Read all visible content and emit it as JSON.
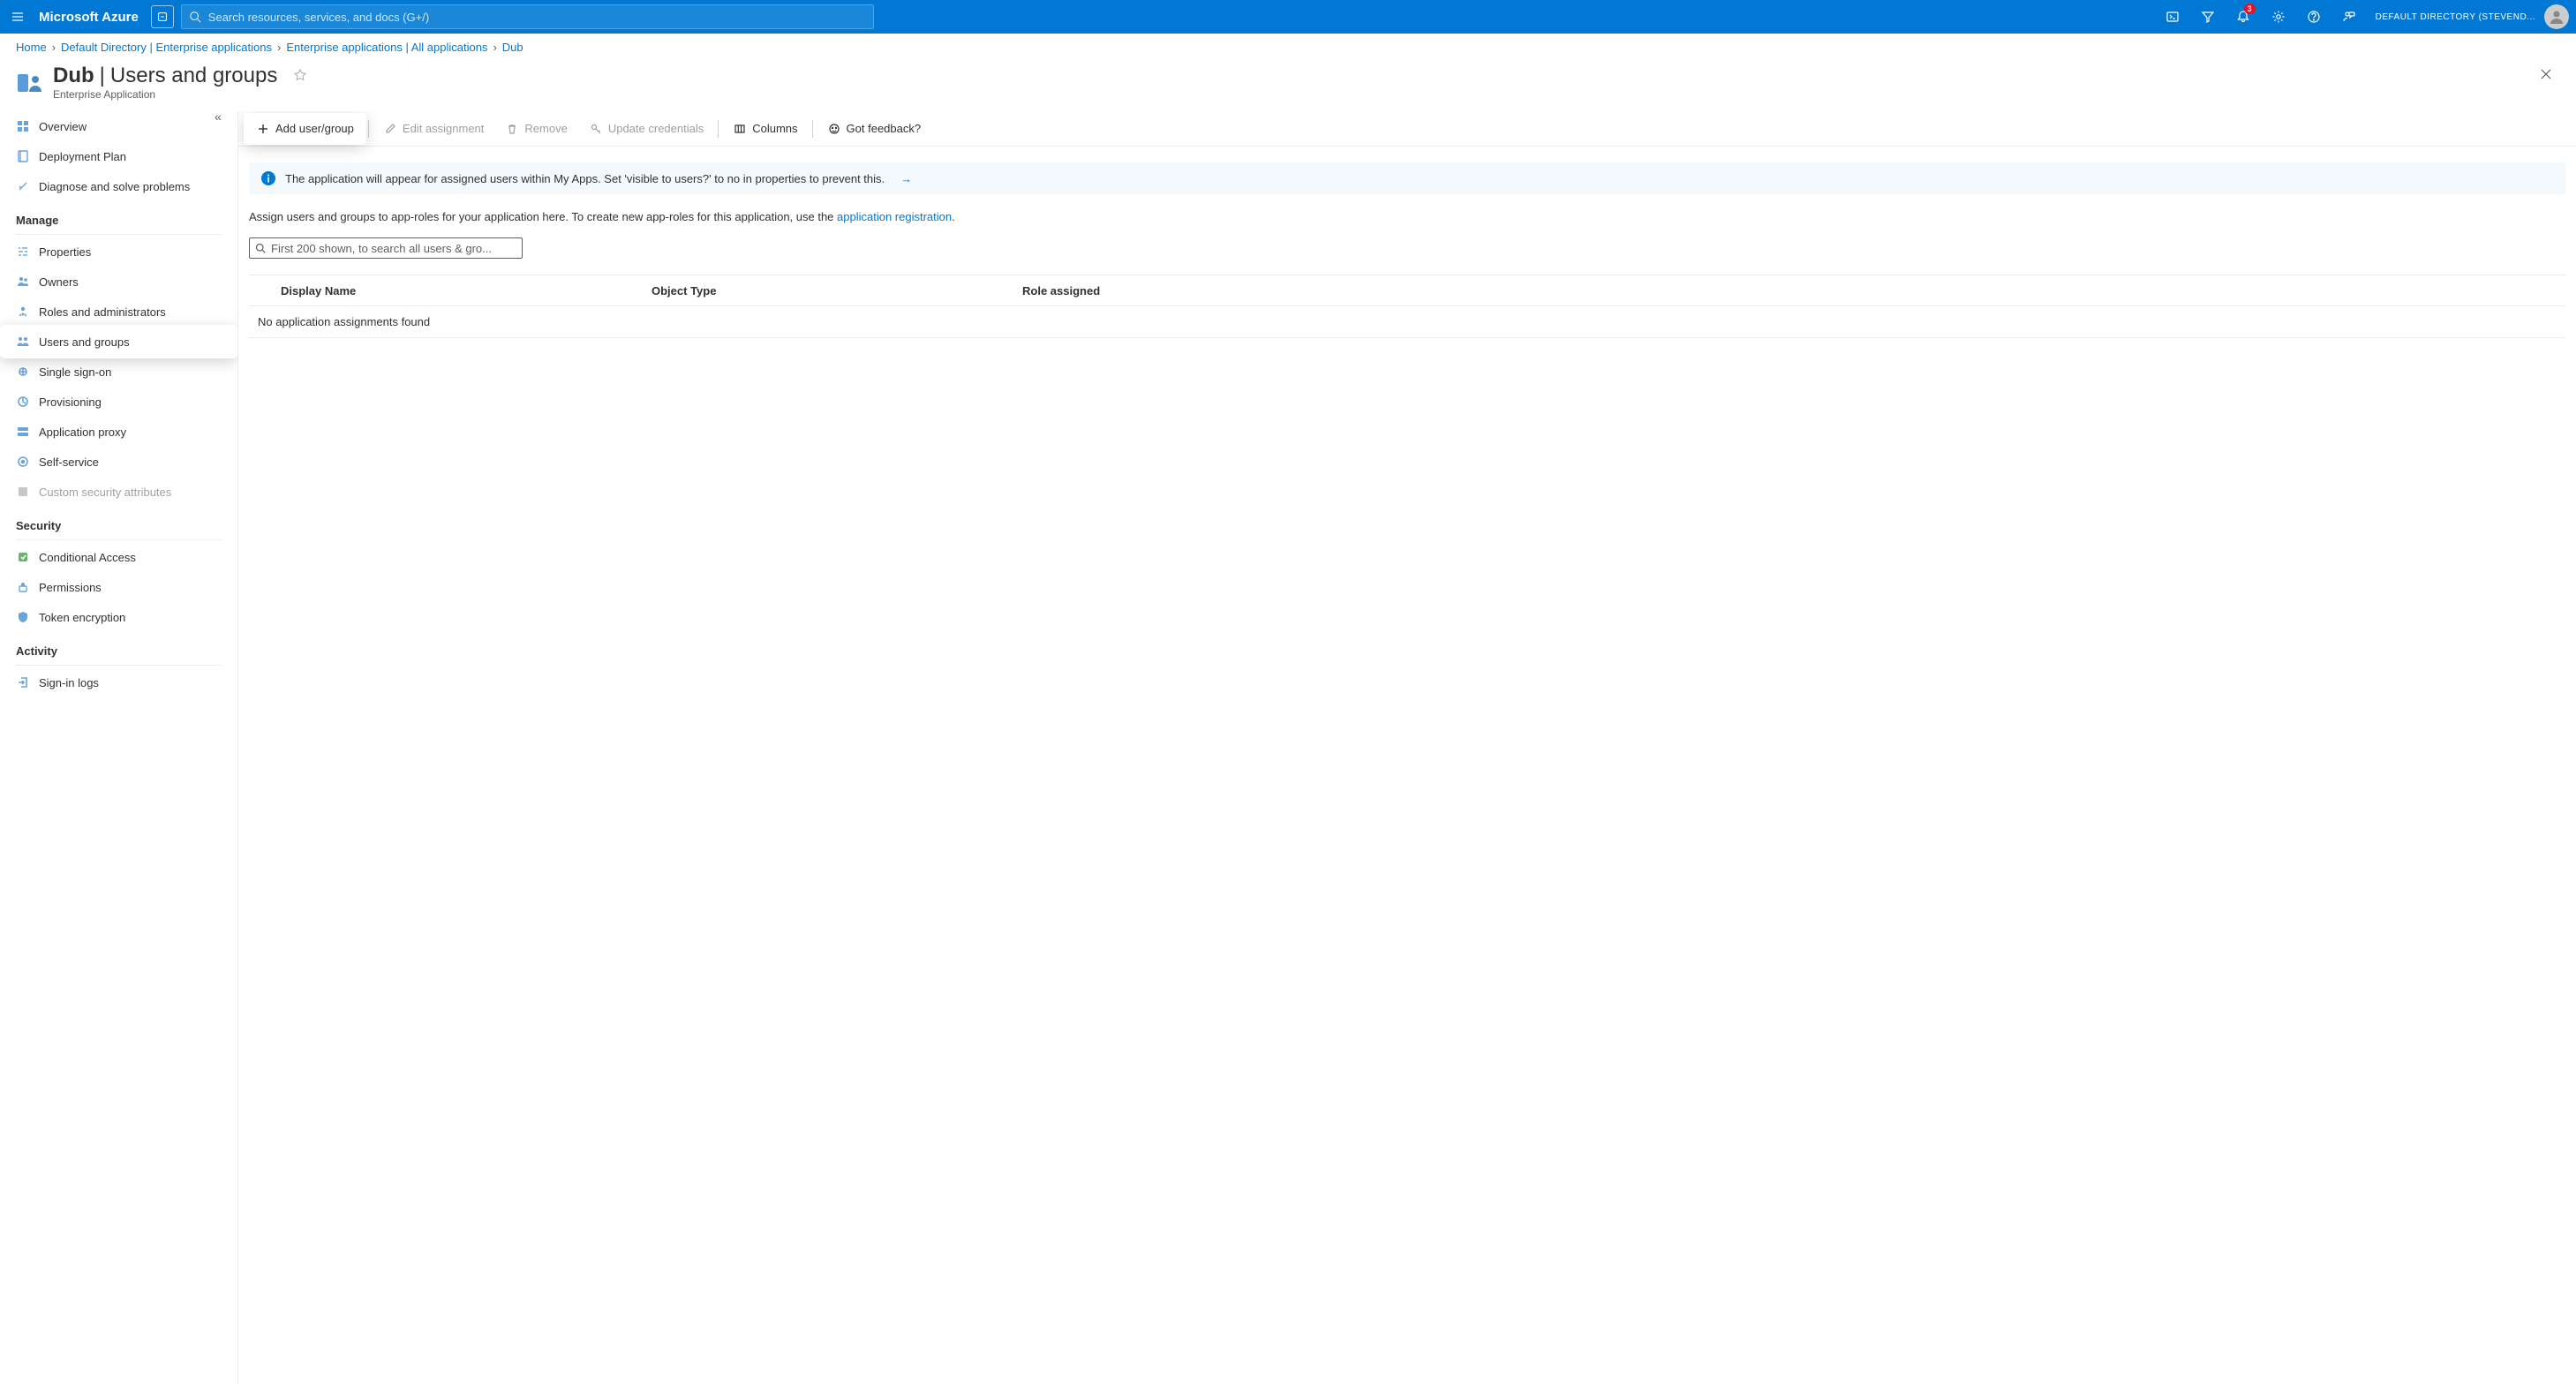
{
  "topbar": {
    "brand": "Microsoft Azure",
    "search_placeholder": "Search resources, services, and docs (G+/)",
    "notification_badge": "3",
    "tenant_label": "DEFAULT DIRECTORY (STEVEND..."
  },
  "breadcrumb": {
    "items": [
      {
        "label": "Home",
        "link": true
      },
      {
        "label": "Default Directory | Enterprise applications",
        "link": true
      },
      {
        "label": "Enterprise applications | All applications",
        "link": true
      },
      {
        "label": "Dub",
        "link": true
      }
    ]
  },
  "blade": {
    "title_app": "Dub",
    "title_sep": " | ",
    "title_section": "Users and groups",
    "subtitle": "Enterprise Application"
  },
  "leftnav": {
    "general": [
      {
        "label": "Overview",
        "icon": "overview"
      },
      {
        "label": "Deployment Plan",
        "icon": "deploy"
      },
      {
        "label": "Diagnose and solve problems",
        "icon": "diagnose"
      }
    ],
    "manage_header": "Manage",
    "manage": [
      {
        "label": "Properties",
        "icon": "properties"
      },
      {
        "label": "Owners",
        "icon": "owners"
      },
      {
        "label": "Roles and administrators",
        "icon": "roles"
      },
      {
        "label": "Users and groups",
        "icon": "users",
        "active": true
      },
      {
        "label": "Single sign-on",
        "icon": "sso"
      },
      {
        "label": "Provisioning",
        "icon": "provisioning"
      },
      {
        "label": "Application proxy",
        "icon": "proxy"
      },
      {
        "label": "Self-service",
        "icon": "selfservice"
      },
      {
        "label": "Custom security attributes",
        "icon": "csa",
        "disabled": true
      }
    ],
    "security_header": "Security",
    "security": [
      {
        "label": "Conditional Access",
        "icon": "condaccess"
      },
      {
        "label": "Permissions",
        "icon": "perms"
      },
      {
        "label": "Token encryption",
        "icon": "token"
      }
    ],
    "activity_header": "Activity",
    "activity": [
      {
        "label": "Sign-in logs",
        "icon": "signin"
      }
    ]
  },
  "toolbar": {
    "add_label": "Add user/group",
    "edit_label": "Edit assignment",
    "remove_label": "Remove",
    "update_label": "Update credentials",
    "columns_label": "Columns",
    "feedback_label": "Got feedback?"
  },
  "infobar": {
    "text": "The application will appear for assigned users within My Apps. Set 'visible to users?' to no in properties to prevent this."
  },
  "assigntext": {
    "pre": "Assign users and groups to app-roles for your application here. To create new app-roles for this application, use the ",
    "link": "application registration",
    "post": "."
  },
  "searchlist_placeholder": "First 200 shown, to search all users & gro...",
  "table": {
    "col1": "Display Name",
    "col2": "Object Type",
    "col3": "Role assigned",
    "empty": "No application assignments found"
  }
}
